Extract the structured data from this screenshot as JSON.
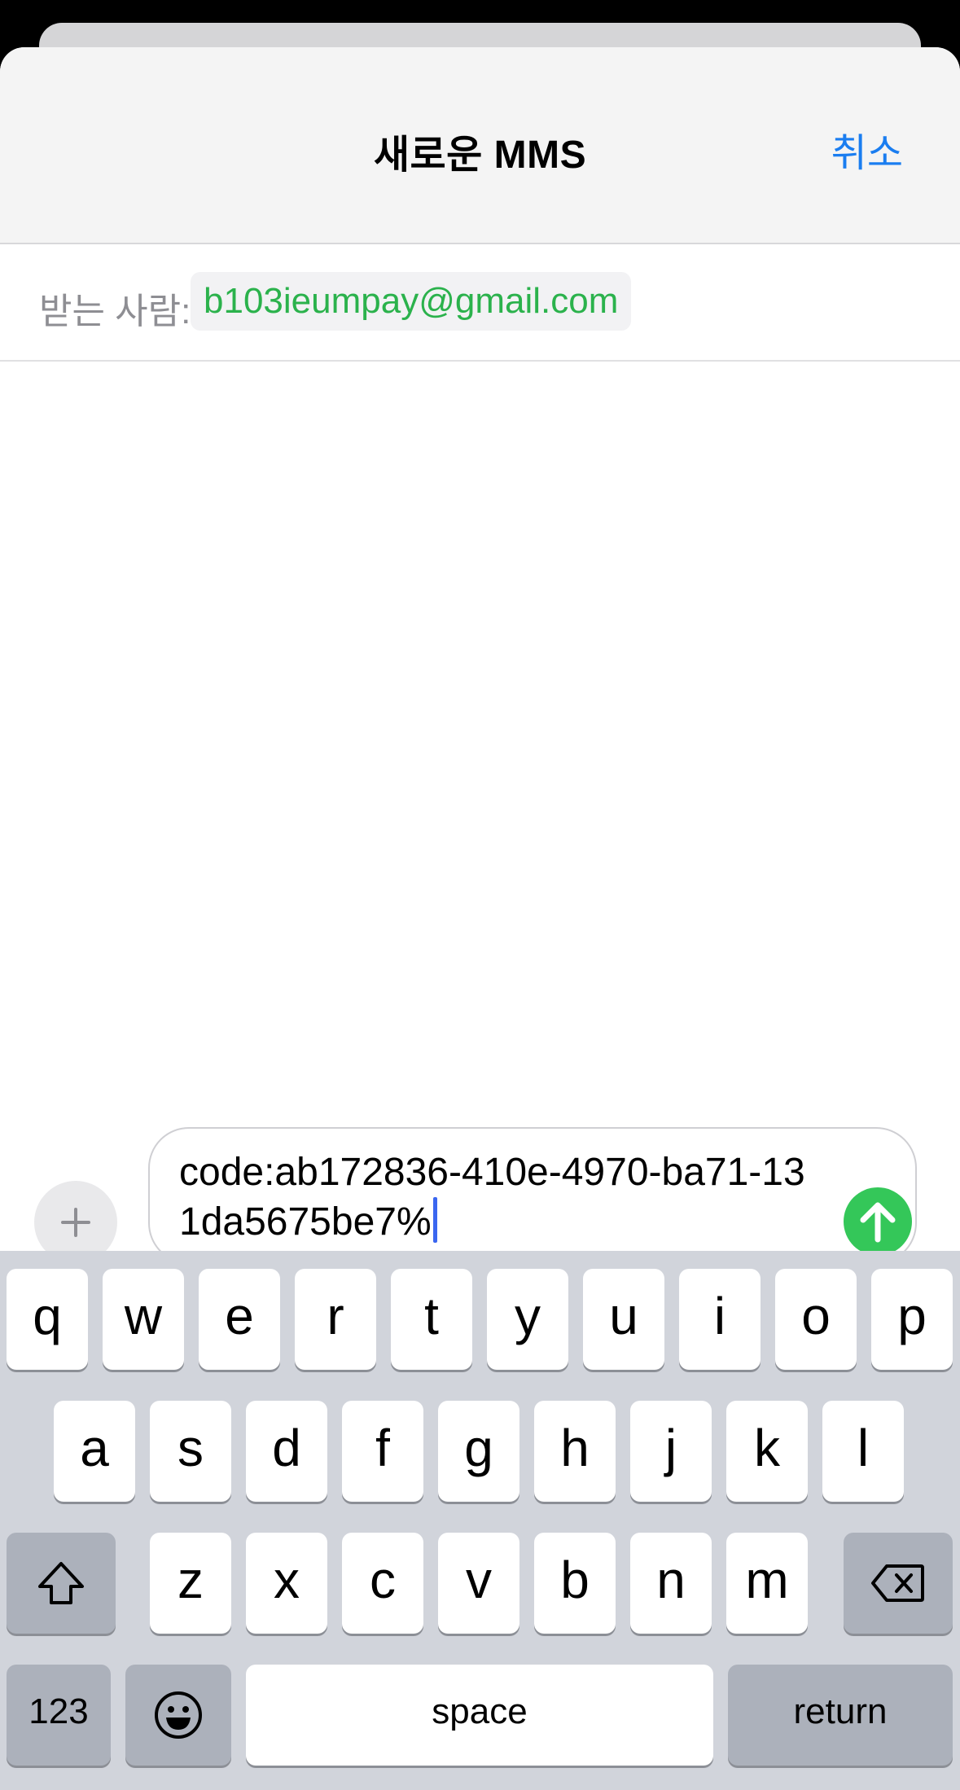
{
  "header": {
    "title": "새로운 MMS",
    "cancel_label": "취소"
  },
  "recipient": {
    "label": "받는 사람:",
    "address": "b103ieumpay@gmail.com"
  },
  "compose": {
    "message_text": "code:ab172836-410e-4970-ba71-131da5675be7%",
    "attach_icon": "plus-icon",
    "send_icon": "arrow-up-icon"
  },
  "keyboard": {
    "row1": [
      "q",
      "w",
      "e",
      "r",
      "t",
      "y",
      "u",
      "i",
      "o",
      "p"
    ],
    "row2": [
      "a",
      "s",
      "d",
      "f",
      "g",
      "h",
      "j",
      "k",
      "l"
    ],
    "row3": [
      "z",
      "x",
      "c",
      "v",
      "b",
      "n",
      "m"
    ],
    "numbers_label": "123",
    "space_label": "space",
    "return_label": "return",
    "shift_icon": "shift-icon",
    "backspace_icon": "backspace-icon",
    "emoji_icon": "emoji-icon"
  },
  "colors": {
    "accent_blue": "#1a7df0",
    "recipient_green": "#2bb24c",
    "send_green": "#34c759",
    "keyboard_bg": "#d1d4db"
  }
}
